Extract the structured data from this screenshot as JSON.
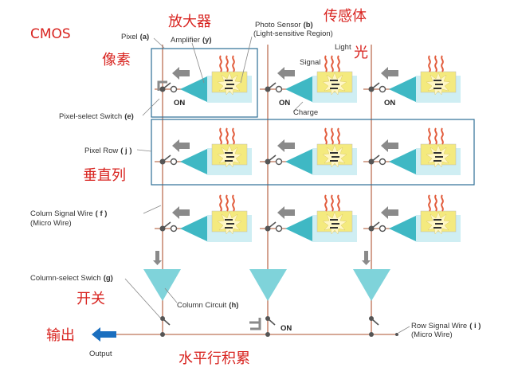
{
  "labels": {
    "cmos": "CMOS",
    "cn_amplifier": "放大器",
    "cn_sensor": "传感体",
    "cn_pixel": "像素",
    "cn_light": "光",
    "cn_vertical": "垂直列",
    "cn_switch": "开关",
    "cn_output": "输出",
    "cn_horizontal": "水平行积累",
    "pixel": "Pixel",
    "pixel_tag": "(a)",
    "amplifier": "Amplifier",
    "amplifier_tag": "(y)",
    "photo_sensor": "Photo Sensor",
    "photo_sensor_tag": "(b)",
    "photo_sensor_sub": "(Light-sensitive Region)",
    "light": "Light",
    "signal": "Signal",
    "charge": "Charge",
    "pixel_select": "Pixel-select Switch",
    "pixel_select_tag": "(e)",
    "pixel_row": "Pixel Row",
    "pixel_row_tag": "( j )",
    "column_wire": "Colum Signal Wire",
    "column_wire_tag": "( f )",
    "micro_wire": "(Micro Wire)",
    "column_select": "Column-select Swich",
    "column_select_tag": "(g)",
    "column_circuit": "Column Circuit",
    "column_circuit_tag": "(h)",
    "row_wire": "Row Signal Wire",
    "row_wire_tag": "( i )",
    "output": "Output",
    "on": "ON"
  },
  "colors": {
    "red_text": "#d8231f",
    "wire": "#c98b74",
    "amplifier": "#3fb8c4",
    "column_circuit": "#7fd3da",
    "sensor_base": "#cfeef3",
    "sensor_core": "#f4ea7e",
    "light_waves": "#e25c3c",
    "outline_box": "#2d6f95",
    "gray_arrow": "#8a8a8a",
    "output_arrow": "#1b6fbf"
  },
  "icons": [
    "light-wave-icon",
    "gray-arrow-icon",
    "output-arrow-icon",
    "switch-icon"
  ]
}
